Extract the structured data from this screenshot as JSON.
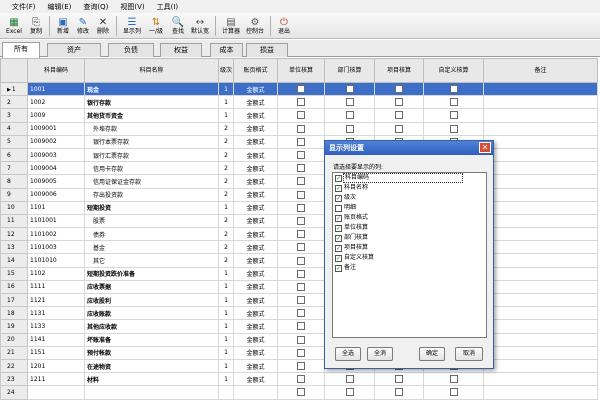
{
  "menu": [
    "文件(F)",
    "编辑(E)",
    "查询(Q)",
    "视图(V)",
    "工具(I)"
  ],
  "toolbar": [
    {
      "label": "Excel",
      "icon": "excel-icon",
      "glyph": "▦",
      "color": "#1f7a2e"
    },
    {
      "label": "复制",
      "icon": "copy-icon",
      "glyph": "⎘",
      "color": "#444"
    },
    {
      "label": "新增",
      "icon": "add-icon",
      "glyph": "▣",
      "color": "#2a6bb8"
    },
    {
      "label": "修改",
      "icon": "edit-icon",
      "glyph": "✎",
      "color": "#2a6bb8"
    },
    {
      "label": "删除",
      "icon": "delete-icon",
      "glyph": "✕",
      "color": "#333"
    },
    {
      "label": "显示列",
      "icon": "columns-icon",
      "glyph": "☰",
      "color": "#2a6bb8"
    },
    {
      "label": "一/级",
      "icon": "level-icon",
      "glyph": "⇅",
      "color": "#c07a10"
    },
    {
      "label": "查找",
      "icon": "find-icon",
      "glyph": "🔍",
      "color": "#555"
    },
    {
      "label": "默认宽",
      "icon": "width-icon",
      "glyph": "↔",
      "color": "#555"
    },
    {
      "label": "计算器",
      "icon": "calculator-icon",
      "glyph": "▤",
      "color": "#555"
    },
    {
      "label": "控制台",
      "icon": "console-icon",
      "glyph": "⚙",
      "color": "#555"
    },
    {
      "label": "退出",
      "icon": "exit-icon",
      "glyph": "⏻",
      "color": "#b83a2a"
    }
  ],
  "tabs": [
    "所有",
    "资产",
    "负债",
    "权益",
    "成本",
    "损益"
  ],
  "columns": [
    "科目编码",
    "科目名称",
    "级次",
    "账页格式",
    "单位核算",
    "部门核算",
    "项目核算",
    "自定义核算",
    "备注"
  ],
  "rows": [
    {
      "n": "1",
      "code": "1001",
      "name": "现金",
      "level": "1",
      "fmt": "金额式",
      "bold": true
    },
    {
      "n": "2",
      "code": "1002",
      "name": "银行存款",
      "level": "1",
      "fmt": "金额式",
      "bold": true
    },
    {
      "n": "3",
      "code": "1009",
      "name": "其他货币资金",
      "level": "1",
      "fmt": "金额式",
      "bold": true
    },
    {
      "n": "4",
      "code": "1009001",
      "name": "外埠存款",
      "level": "2",
      "fmt": "金额式",
      "bold": false
    },
    {
      "n": "5",
      "code": "1009002",
      "name": "银行本票存款",
      "level": "2",
      "fmt": "金额式",
      "bold": false
    },
    {
      "n": "6",
      "code": "1009003",
      "name": "银行汇票存款",
      "level": "2",
      "fmt": "金额式",
      "bold": false
    },
    {
      "n": "7",
      "code": "1009004",
      "name": "信用卡存款",
      "level": "2",
      "fmt": "金额式",
      "bold": false
    },
    {
      "n": "8",
      "code": "1009005",
      "name": "信用证保证金存款",
      "level": "2",
      "fmt": "金额式",
      "bold": false
    },
    {
      "n": "9",
      "code": "1009006",
      "name": "存出投资款",
      "level": "2",
      "fmt": "金额式",
      "bold": false
    },
    {
      "n": "10",
      "code": "1101",
      "name": "短期投资",
      "level": "1",
      "fmt": "金额式",
      "bold": true
    },
    {
      "n": "11",
      "code": "1101001",
      "name": "股票",
      "level": "2",
      "fmt": "金额式",
      "bold": false
    },
    {
      "n": "12",
      "code": "1101002",
      "name": "债券",
      "level": "2",
      "fmt": "金额式",
      "bold": false
    },
    {
      "n": "13",
      "code": "1101003",
      "name": "基金",
      "level": "2",
      "fmt": "金额式",
      "bold": false
    },
    {
      "n": "14",
      "code": "1101010",
      "name": "其它",
      "level": "2",
      "fmt": "金额式",
      "bold": false
    },
    {
      "n": "15",
      "code": "1102",
      "name": "短期投资跌价准备",
      "level": "1",
      "fmt": "金额式",
      "bold": true
    },
    {
      "n": "16",
      "code": "1111",
      "name": "应收票据",
      "level": "1",
      "fmt": "金额式",
      "bold": true
    },
    {
      "n": "17",
      "code": "1121",
      "name": "应收股利",
      "level": "1",
      "fmt": "金额式",
      "bold": true
    },
    {
      "n": "18",
      "code": "1131",
      "name": "应收账款",
      "level": "1",
      "fmt": "金额式",
      "bold": true
    },
    {
      "n": "19",
      "code": "1133",
      "name": "其他应收款",
      "level": "1",
      "fmt": "金额式",
      "bold": true
    },
    {
      "n": "20",
      "code": "1141",
      "name": "坏账准备",
      "level": "1",
      "fmt": "金额式",
      "bold": true
    },
    {
      "n": "21",
      "code": "1151",
      "name": "预付帐款",
      "level": "1",
      "fmt": "金额式",
      "bold": true
    },
    {
      "n": "22",
      "code": "1201",
      "name": "在途物资",
      "level": "1",
      "fmt": "金额式",
      "bold": true
    },
    {
      "n": "23",
      "code": "1211",
      "name": "材料",
      "level": "1",
      "fmt": "金额式",
      "bold": true
    },
    {
      "n": "24",
      "code": "",
      "name": "",
      "level": "",
      "fmt": "",
      "bold": false
    }
  ],
  "dialog": {
    "title": "显示列设置",
    "instruction": "请选择要显示的列:",
    "items": [
      {
        "label": "科目编码",
        "checked": true
      },
      {
        "label": "科目名称",
        "checked": true
      },
      {
        "label": "级次",
        "checked": true
      },
      {
        "label": "明细",
        "checked": false
      },
      {
        "label": "账页格式",
        "checked": true
      },
      {
        "label": "单位核算",
        "checked": true
      },
      {
        "label": "部门核算",
        "checked": true
      },
      {
        "label": "项目核算",
        "checked": true
      },
      {
        "label": "自定义核算",
        "checked": true
      },
      {
        "label": "备注",
        "checked": true
      }
    ],
    "buttons": {
      "select_all": "全选",
      "clear_all": "全消",
      "ok": "确定",
      "cancel": "取消"
    }
  },
  "colors": {
    "selection": "#3d6fc8",
    "dialog_title": "#2f5fbd",
    "close": "#d94b32"
  }
}
